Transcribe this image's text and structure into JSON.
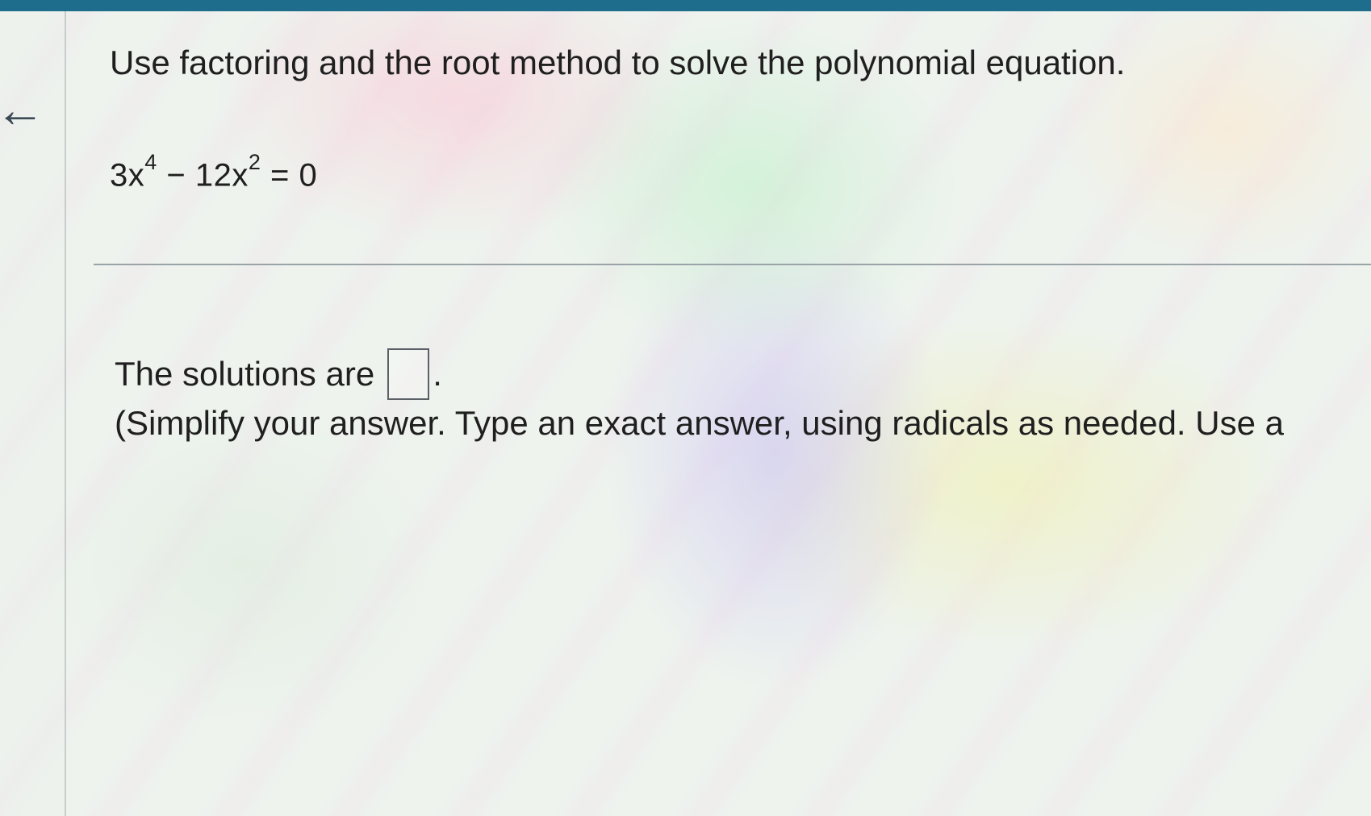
{
  "header": {
    "back_glyph": "←"
  },
  "question": {
    "prompt": "Use factoring and the root method to solve the polynomial equation.",
    "equation": {
      "term1_coef": "3x",
      "term1_exp": "4",
      "operator": " − 12x",
      "term2_exp": "2",
      "rhs": " = 0"
    }
  },
  "answer": {
    "label": "The solutions are",
    "input_value": "",
    "period": ".",
    "instruction": "(Simplify your answer. Type an exact answer, using radicals as needed. Use a"
  },
  "colors": {
    "topbar": "#1f6d8c"
  }
}
